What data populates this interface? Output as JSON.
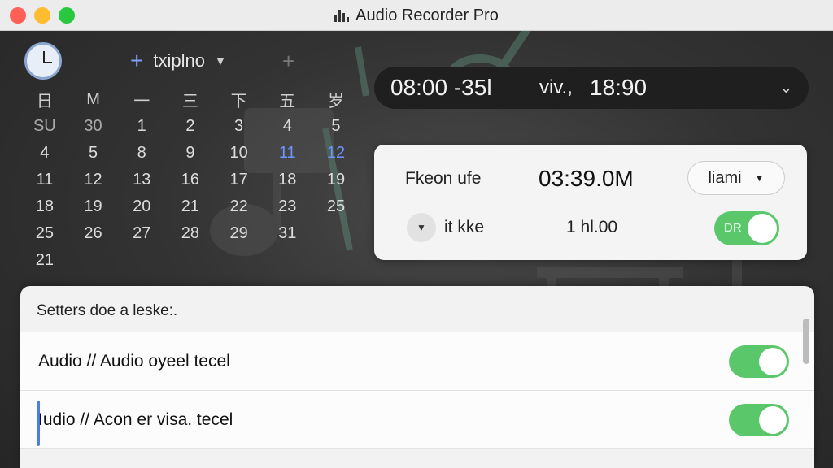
{
  "window": {
    "title": "Audio Recorder Pro",
    "title_icon": "bar-chart-icon"
  },
  "calendar": {
    "clock_icon": "clock-icon",
    "view_label": "txiplno",
    "weekdays": [
      "日",
      "M",
      "一",
      "三",
      "下",
      "五",
      "岁"
    ],
    "weeks": [
      [
        "SU",
        "30",
        "1",
        "2",
        "3",
        "4",
        "5"
      ],
      [
        "4",
        "5",
        "8",
        "9",
        "10",
        "11",
        "12"
      ],
      [
        "11",
        "12",
        "13",
        "16",
        "17",
        "18",
        "19"
      ],
      [
        "18",
        "19",
        "20",
        "21",
        "22",
        "23",
        "25"
      ],
      [
        "25",
        "26",
        "27",
        "28",
        "29",
        "31",
        ""
      ],
      [
        "21",
        "",
        "",
        "",
        "",
        "",
        ""
      ]
    ],
    "highlighted_days": [
      "11",
      "12"
    ],
    "accent_color": "#6c95ff"
  },
  "time_range": {
    "start": "08:00 -35l",
    "middle": "viv.,",
    "end": "18:90"
  },
  "recording": {
    "label": "Fkeon ufe",
    "time": "03:39.0M",
    "dropdown_value": "liami",
    "row2_label": "it kke",
    "row2_value": "1 hl.00",
    "toggle_text": "DR",
    "toggle_on": true
  },
  "settings": {
    "header": "Setters doe a leske:.",
    "rows": [
      {
        "text": "Audio // Audio oyeel tecel",
        "on": true
      },
      {
        "text": "Iudio // Acon er visa. tecel",
        "on": true
      }
    ]
  },
  "colors": {
    "toggle_green": "#5ac86a",
    "close": "#fe5f57",
    "minimize": "#febc2e",
    "maximize": "#28c840"
  }
}
